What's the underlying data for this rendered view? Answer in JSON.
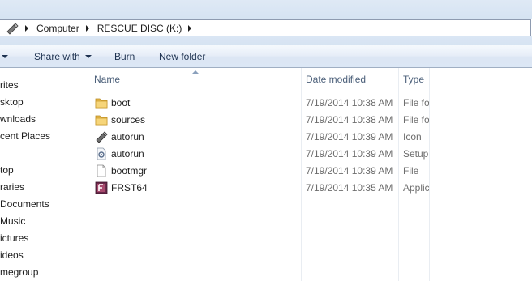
{
  "address_bar": {
    "breadcrumbs": [
      "Computer",
      "RESCUE DISC (K:)"
    ]
  },
  "toolbar": {
    "organize_caret": "",
    "share_with": "Share with",
    "burn": "Burn",
    "new_folder": "New folder"
  },
  "nav_pane": {
    "items": [
      "rites",
      "sktop",
      "wnloads",
      "cent Places",
      "top",
      "raries",
      "Documents",
      "Music",
      "ictures",
      "ideos",
      "megroup"
    ]
  },
  "file_list": {
    "columns": [
      "Name",
      "Date modified",
      "Type"
    ],
    "rows": [
      {
        "name": "boot",
        "date": "7/19/2014 10:38 AM",
        "type": "File fo",
        "icon": "folder-icon"
      },
      {
        "name": "sources",
        "date": "7/19/2014 10:38 AM",
        "type": "File fo",
        "icon": "folder-icon"
      },
      {
        "name": "autorun",
        "date": "7/19/2014 10:39 AM",
        "type": "Icon",
        "icon": "usb-drive-icon"
      },
      {
        "name": "autorun",
        "date": "7/19/2014 10:39 AM",
        "type": "Setup",
        "icon": "setup-file-icon"
      },
      {
        "name": "bootmgr",
        "date": "7/19/2014 10:39 AM",
        "type": "File",
        "icon": "blank-file-icon"
      },
      {
        "name": "FRST64",
        "date": "7/19/2014 10:35 AM",
        "type": "Applic",
        "icon": "frst-app-icon"
      }
    ]
  }
}
